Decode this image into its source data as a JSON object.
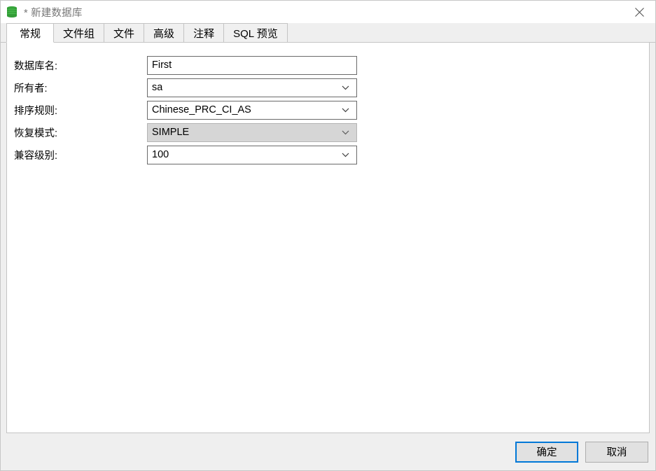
{
  "window": {
    "title": "* 新建数据库",
    "icon": "database-icon",
    "close_label": "close-icon"
  },
  "tabs": [
    {
      "label": "常规",
      "active": true
    },
    {
      "label": "文件组",
      "active": false
    },
    {
      "label": "文件",
      "active": false
    },
    {
      "label": "高级",
      "active": false
    },
    {
      "label": "注释",
      "active": false
    },
    {
      "label": "SQL 预览",
      "active": false
    }
  ],
  "form": {
    "fields": [
      {
        "label": "数据库名:",
        "value": "First",
        "type": "text",
        "disabled": false,
        "has_dropdown": false
      },
      {
        "label": "所有者:",
        "value": "sa",
        "type": "combo",
        "disabled": false,
        "has_dropdown": true
      },
      {
        "label": "排序规则:",
        "value": "Chinese_PRC_CI_AS",
        "type": "combo",
        "disabled": false,
        "has_dropdown": true
      },
      {
        "label": "恢复模式:",
        "value": "SIMPLE",
        "type": "combo",
        "disabled": true,
        "has_dropdown": true
      },
      {
        "label": "兼容级别:",
        "value": "100",
        "type": "combo",
        "disabled": false,
        "has_dropdown": true
      }
    ]
  },
  "footer": {
    "ok_label": "确定",
    "cancel_label": "取消"
  },
  "colors": {
    "accent": "#0078d7",
    "titlebar_bg": "#ffffff",
    "dialog_bg": "#efefef",
    "panel_bg": "#ffffff",
    "icon_green": "#2e9c32",
    "title_text": "#767676",
    "disabled_field_bg": "#d6d6d6",
    "field_border": "#6a6a6a",
    "button_bg": "#e1e1e1"
  }
}
